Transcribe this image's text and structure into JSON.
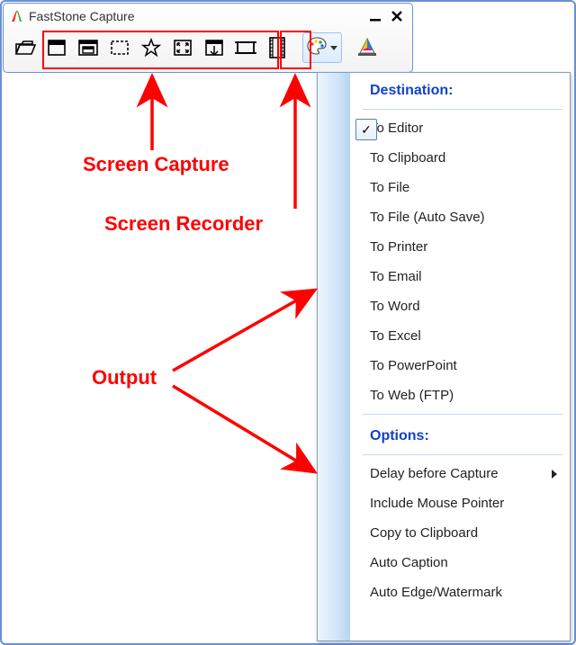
{
  "title": "FastStone Capture",
  "annotations": {
    "capture": "Screen Capture",
    "recorder": "Screen Recorder",
    "output": "Output"
  },
  "toolbar": {
    "open": "open-file",
    "capture_buttons": [
      "capture-active-window",
      "capture-window-object",
      "capture-rectangle",
      "capture-freehand",
      "capture-full-screen",
      "capture-scrolling",
      "capture-fixed-region"
    ],
    "recorder": "screen-recorder",
    "settings": "output-settings",
    "draw": "screen-draw"
  },
  "menu": {
    "hdr_dest": "Destination:",
    "dest": [
      "To Editor",
      "To Clipboard",
      "To File",
      "To File (Auto Save)",
      "To Printer",
      "To Email",
      "To Word",
      "To Excel",
      "To PowerPoint",
      "To Web (FTP)"
    ],
    "checked_index": 0,
    "hdr_opt": "Options:",
    "opt": [
      "Delay before Capture",
      "Include Mouse Pointer",
      "Copy to Clipboard",
      "Auto Caption",
      "Auto Edge/Watermark"
    ],
    "opt_submenu_index": 0
  }
}
